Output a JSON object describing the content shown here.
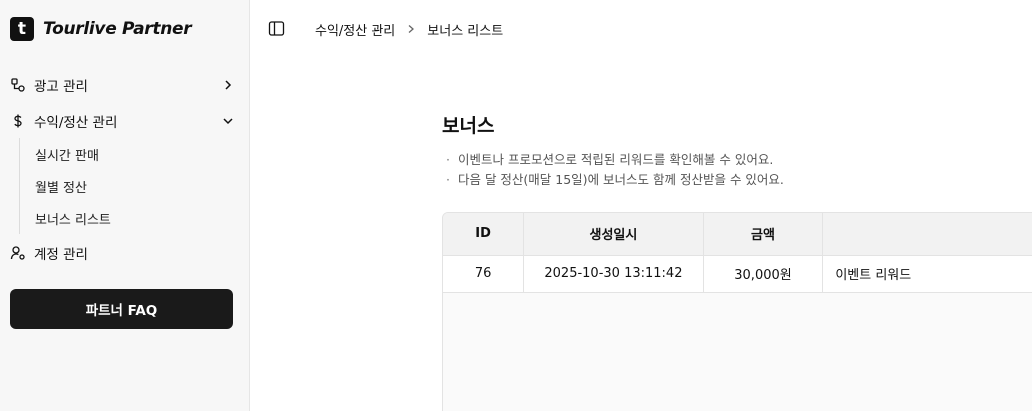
{
  "brand": {
    "logo_letter": "t",
    "name": "Tourlive Partner"
  },
  "sidebar": {
    "items": [
      {
        "label": "광고 관리",
        "icon": "ad-icon"
      },
      {
        "label": "수익/정산 관리",
        "icon": "dollar-icon"
      },
      {
        "label": "계정 관리",
        "icon": "user-settings-icon"
      }
    ],
    "subitems": [
      {
        "label": "실시간 판매"
      },
      {
        "label": "월별 정산"
      },
      {
        "label": "보너스 리스트"
      }
    ],
    "faq_button": "파트너 FAQ"
  },
  "breadcrumb": {
    "parent": "수익/정산 관리",
    "current": "보너스 리스트"
  },
  "main": {
    "title": "보너스",
    "notes": [
      "이벤트나 프로모션으로 적립된 리워드를 확인해볼 수 있어요.",
      "다음 달 정산(매달 15일)에 보너스도 함께 정산받을 수 있어요."
    ],
    "note_bullet": "·"
  },
  "table": {
    "headers": [
      "ID",
      "생성일시",
      "금액",
      ""
    ],
    "rows": [
      {
        "id": "76",
        "created_at": "2025-10-30 13:11:42",
        "amount": "30,000원",
        "description": "이벤트 리워드"
      }
    ]
  }
}
